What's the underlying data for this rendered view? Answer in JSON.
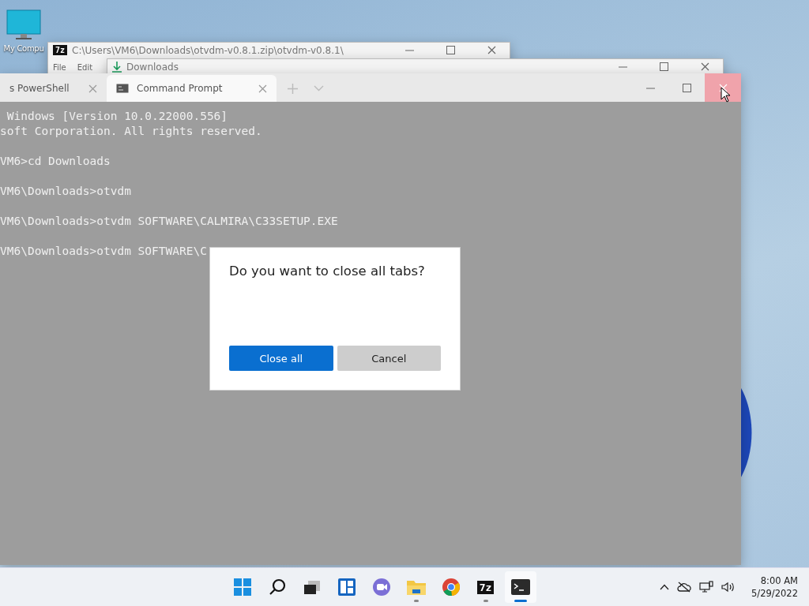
{
  "desktop": {
    "icons": [
      {
        "label": "My Compu"
      }
    ]
  },
  "archive_window": {
    "icon_label": "7z",
    "title": "C:\\Users\\VM6\\Downloads\\otvdm-v0.8.1.zip\\otvdm-v0.8.1\\",
    "menu": [
      "File",
      "Edit"
    ]
  },
  "downloads_window": {
    "title": "Downloads"
  },
  "terminal": {
    "tabs": [
      {
        "label": "s PowerShell",
        "selected": false
      },
      {
        "label": "Command Prompt",
        "selected": true
      }
    ],
    "close_hovered": true,
    "blocks": [
      [
        " Windows [Version 10.0.22000.556]",
        "soft Corporation. All rights reserved."
      ],
      [
        "VM6>cd Downloads"
      ],
      [
        "VM6\\Downloads>otvdm"
      ],
      [
        "VM6\\Downloads>otvdm SOFTWARE\\CALMIRA\\C33SETUP.EXE"
      ],
      [
        "VM6\\Downloads>otvdm SOFTWARE\\C"
      ]
    ]
  },
  "dialog": {
    "title": "Do you want to close all tabs?",
    "buttons": [
      {
        "label": "Close all",
        "kind": "primary"
      },
      {
        "label": "Cancel",
        "kind": "secondary"
      }
    ]
  },
  "taskbar": {
    "apps": [
      {
        "kind": "start",
        "running": false,
        "active": false
      },
      {
        "kind": "search",
        "running": false,
        "active": false
      },
      {
        "kind": "taskview",
        "running": false,
        "active": false
      },
      {
        "kind": "widgets",
        "running": false,
        "active": false
      },
      {
        "kind": "chat",
        "running": false,
        "active": false
      },
      {
        "kind": "folder",
        "running": true,
        "active": false
      },
      {
        "kind": "browser",
        "running": false,
        "active": false
      },
      {
        "kind": "archiver",
        "label": "7z",
        "running": true,
        "active": false
      },
      {
        "kind": "terminal",
        "running": true,
        "active": true
      }
    ],
    "time": "8:00 AM",
    "date": "5/29/2022"
  }
}
